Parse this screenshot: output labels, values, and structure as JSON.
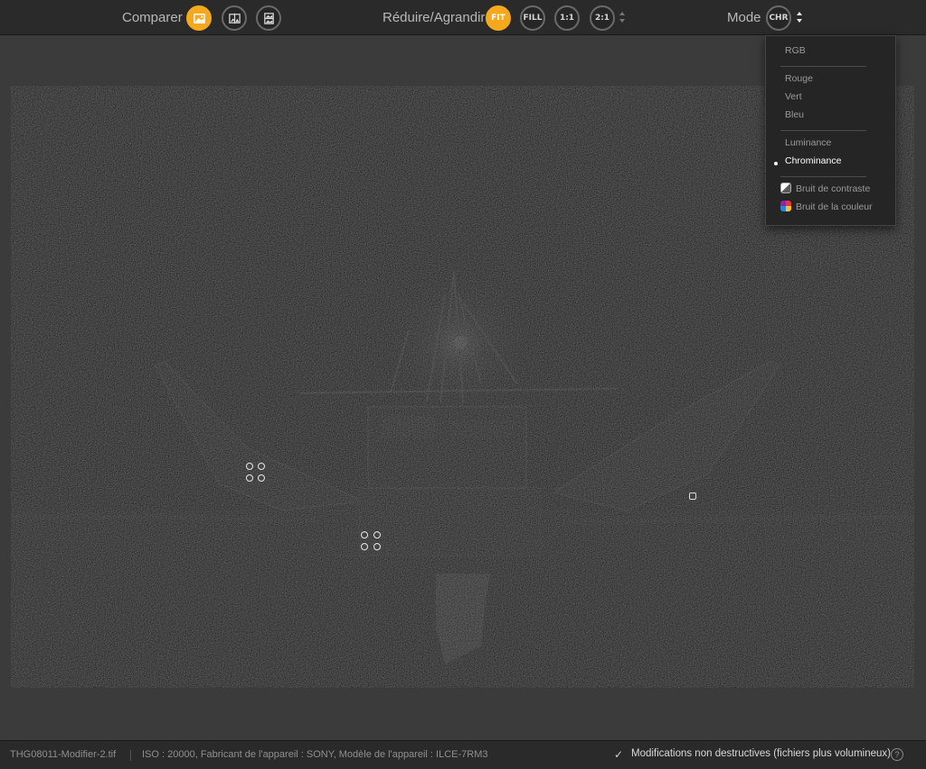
{
  "toolbar": {
    "compare_label": "Comparer",
    "resize_label": "Réduire/Agrandir",
    "zoom_buttons": {
      "fit": "FIT",
      "fill": "FILL",
      "one_to_one": "1:1",
      "two_to_one": "2:1"
    },
    "mode_label": "Mode",
    "mode_value": "CHR",
    "accent_color": "#f4a81d",
    "icons": {
      "compare_single": "image-icon",
      "compare_split": "split-view-icon",
      "compare_stack": "stacked-view-icon"
    }
  },
  "mode_menu": {
    "items": [
      {
        "label": "RGB",
        "selected": false
      },
      {
        "label": "Rouge",
        "selected": false
      },
      {
        "label": "Vert",
        "selected": false
      },
      {
        "label": "Bleu",
        "selected": false
      },
      {
        "label": "Luminance",
        "selected": false
      },
      {
        "label": "Chrominance",
        "selected": true
      },
      {
        "label": "Bruit de contraste",
        "selected": false,
        "icon": "contrast-noise-icon"
      },
      {
        "label": "Bruit de la couleur",
        "selected": false,
        "icon": "color-noise-icon"
      }
    ]
  },
  "status": {
    "filename": "THG08011-Modifier-2.tif",
    "metadata": "ISO : 20000, Fabricant de l'appareil : SONY, Modèle de l'appareil : ILCE-7RM3",
    "non_destructive_label": "Modifications non destructives (fichiers plus volumineux)",
    "non_destructive_checked": true,
    "help": "?"
  }
}
